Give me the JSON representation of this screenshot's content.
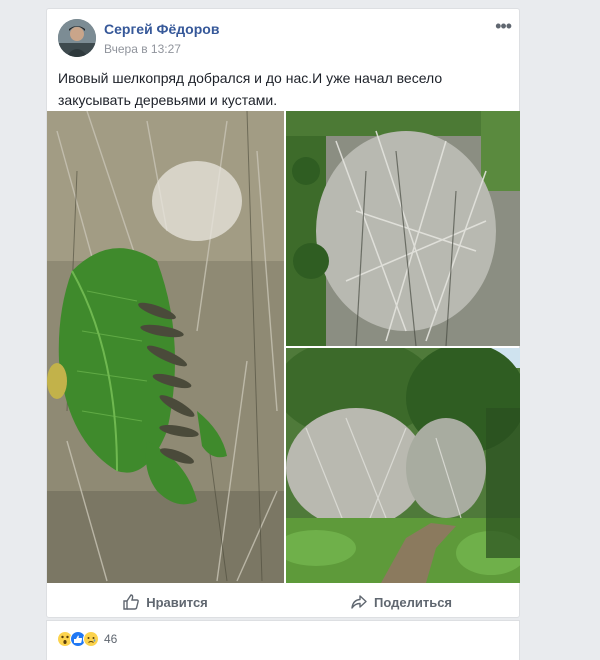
{
  "post": {
    "author": "Сергей Фёдоров",
    "timestamp": "Вчера в 13:27",
    "more_label": "•••",
    "text": "Ивовый шелкопряд добрался и до нас.И уже начал весело закусывать деревьями и кустами."
  },
  "actions": {
    "like_label": "Нравится",
    "share_label": "Поделиться"
  },
  "reactions": {
    "count": "46",
    "types": [
      "wow",
      "like",
      "sad"
    ]
  },
  "images": [
    {
      "name": "caterpillars-on-leaf-photo"
    },
    {
      "name": "webbed-trees-photo"
    },
    {
      "name": "forest-path-photo"
    }
  ],
  "colors": {
    "background": "#e9ebee",
    "card": "#ffffff",
    "author_link": "#365899",
    "muted": "#90949c",
    "action_text": "#606770",
    "like_blue": "#2078f4",
    "reaction_yellow": "#fcd34d"
  }
}
